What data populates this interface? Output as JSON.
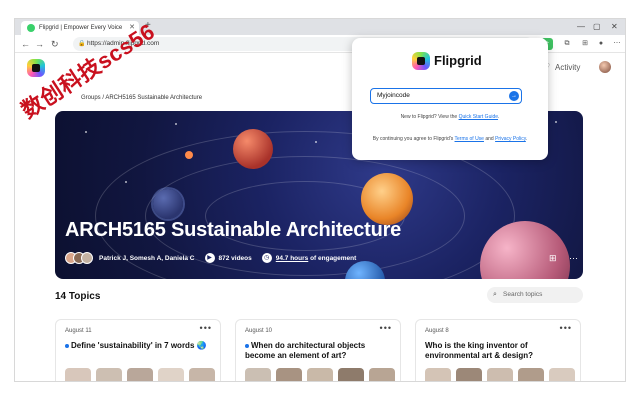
{
  "browser": {
    "tab_title": "Flipgrid | Empower Every Voice",
    "url": "https://admin.flipgrid.com"
  },
  "header": {
    "activity_label": "Activity"
  },
  "breadcrumb": "Groups / ARCH5165 Sustainable Architecture",
  "hero": {
    "title": "ARCH5165 Sustainable Architecture",
    "members": "Patrick J, Somesh A, Daniela C",
    "videos": "872 videos",
    "engagement_value": "94.7 hours",
    "engagement_suffix": " of engagement"
  },
  "topics": {
    "heading": "14 Topics",
    "search_placeholder": "Search topics",
    "cards": [
      {
        "date": "August 11",
        "title": "Define 'sustainability' in 7 words 🌏"
      },
      {
        "date": "August 10",
        "title": "When do architectural objects become an element of art?"
      },
      {
        "date": "August 8",
        "title": "Who is the king inventor of environmental art & design?"
      }
    ]
  },
  "popup": {
    "brand": "Flipgrid",
    "join_value": "Myjoincode",
    "new_prefix": "New to Flipgrid? View the ",
    "new_link": "Quick Start Guide",
    "new_suffix": ".",
    "terms_prefix": "By continuing you agree to Flipgrid's ",
    "terms_link": "Terms of Use",
    "terms_and": " and ",
    "privacy_link": "Privacy Policy",
    "terms_suffix": "."
  },
  "watermark": "数创科技scs56",
  "colors": {
    "accent": "#1a73e8",
    "hero_bg": "#1b2363",
    "watermark": "#c9101e"
  },
  "icons": {
    "search": "search-icon",
    "more": "more-icon",
    "submit": "arrow-right-icon"
  }
}
